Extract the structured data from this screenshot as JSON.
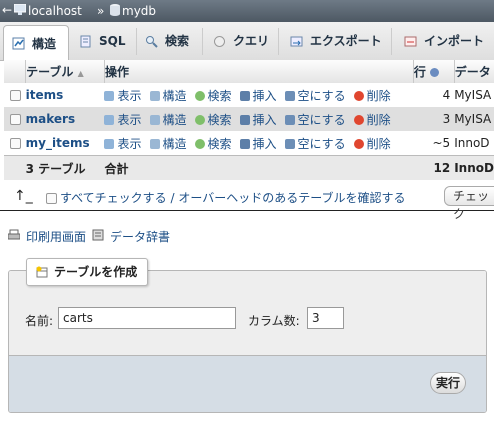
{
  "breadcrumb": {
    "back": "←",
    "server": "localhost",
    "separator": "»",
    "database": "mydb"
  },
  "tabs": [
    {
      "label": "構造",
      "icon": "structure-icon",
      "active": true
    },
    {
      "label": "SQL",
      "icon": "sql-icon"
    },
    {
      "label": "検索",
      "icon": "search-icon"
    },
    {
      "label": "クエリ",
      "icon": "query-icon"
    },
    {
      "label": "エクスポート",
      "icon": "export-icon"
    },
    {
      "label": "インポート",
      "icon": "import-icon"
    }
  ],
  "table": {
    "headers": {
      "table": "テーブル",
      "sort": "▲",
      "action": "操作",
      "rows": "行",
      "data": "データ"
    },
    "actions": [
      "表示",
      "構造",
      "検索",
      "挿入",
      "空にする",
      "削除"
    ],
    "rows": [
      {
        "name": "items",
        "rows": "4",
        "type": "MyISA"
      },
      {
        "name": "makers",
        "rows": "3",
        "type": "MyISA"
      },
      {
        "name": "my_items",
        "rows": "~5",
        "type": "InnoD"
      }
    ],
    "footer": {
      "count": "3 テーブル",
      "sum_label": "合計",
      "rows": "12",
      "type": "InnoD"
    }
  },
  "checkbar": {
    "arrow": "↑_",
    "text": "すべてチェックする / オーバーヘッドのあるテーブルを確認する",
    "select_value": "チェック"
  },
  "links": {
    "print": "印刷用画面",
    "dict": "データ辞書"
  },
  "create": {
    "legend": "テーブルを作成",
    "name_label": "名前:",
    "name_value": "carts",
    "cols_label": "カラム数:",
    "cols_value": "3",
    "go": "実行"
  },
  "colors": {
    "link": "#1d4f86",
    "header_bar": "#5d6872",
    "fieldset_bottom": "#d5dde5"
  }
}
